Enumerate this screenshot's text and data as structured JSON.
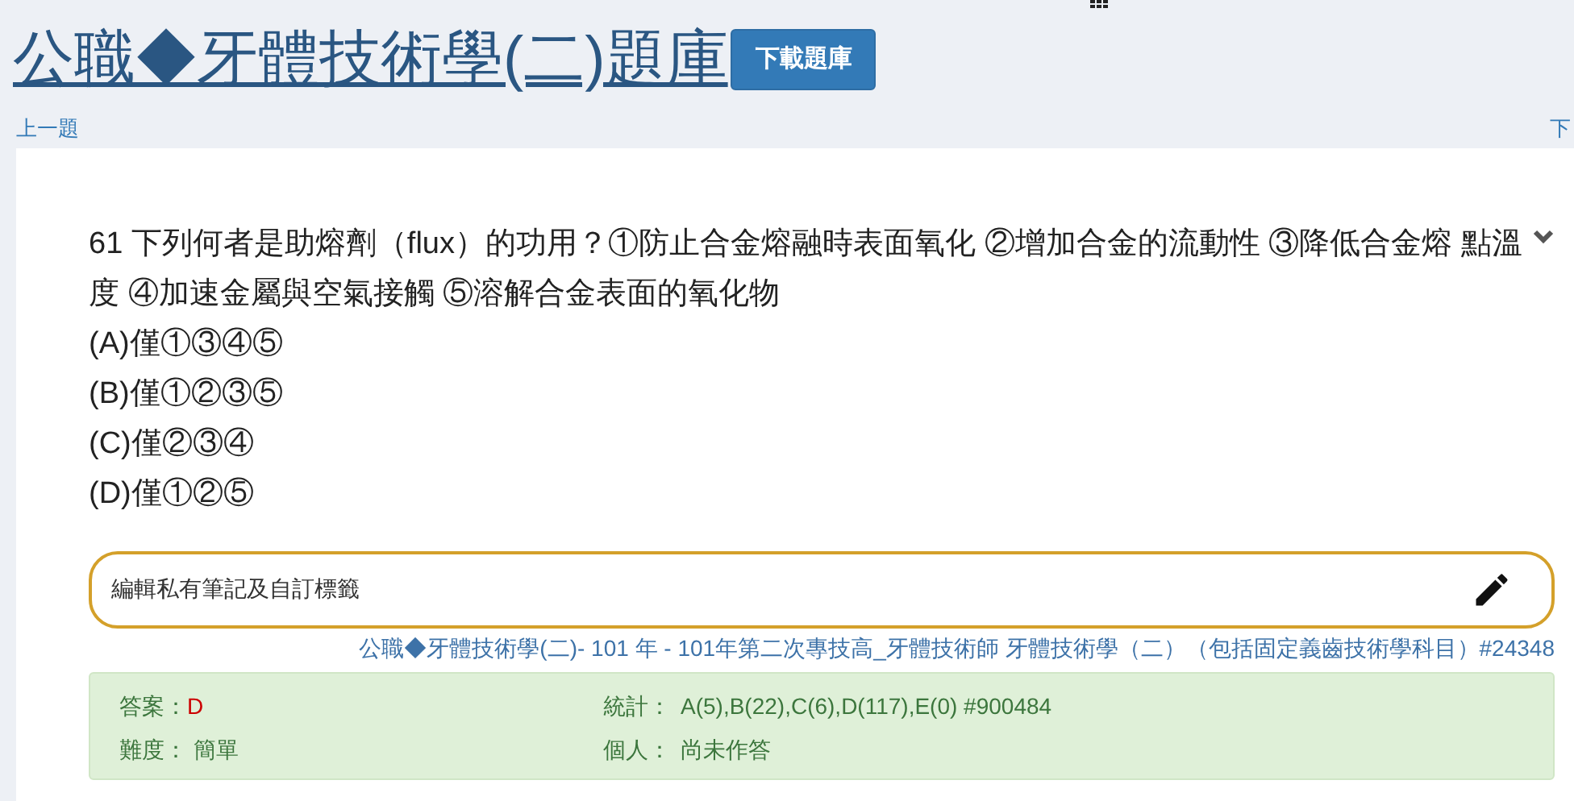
{
  "title": "公職◆牙體技術學(二)題庫",
  "download_button": "下載題庫",
  "nav": {
    "prev": "上一題",
    "next": "下"
  },
  "question": {
    "text": "61 下列何者是助熔劑（flux）的功用？①防止合金熔融時表面氧化 ②增加合金的流動性 ③降低合金熔 點溫度 ④加速金屬與空氣接觸 ⑤溶解合金表面的氧化物",
    "options": [
      "(A)僅①③④⑤",
      "(B)僅①②③⑤",
      "(C)僅②③④",
      "(D)僅①②⑤"
    ]
  },
  "note_field": {
    "placeholder": "編輯私有筆記及自訂標籤"
  },
  "source": "公職◆牙體技術學(二)- 101 年 - 101年第二次專技高_牙體技術師 牙體技術學（二）（包括固定義齒技術學科目）#24348",
  "info": {
    "answer_label": "答案：",
    "answer": "D",
    "difficulty_label": "難度：",
    "difficulty": "簡單",
    "stats_label": "統計：",
    "stats": "A(5),B(22),C(6),D(117),E(0) #900484",
    "personal_label": "個人：",
    "personal": "尚未作答"
  }
}
